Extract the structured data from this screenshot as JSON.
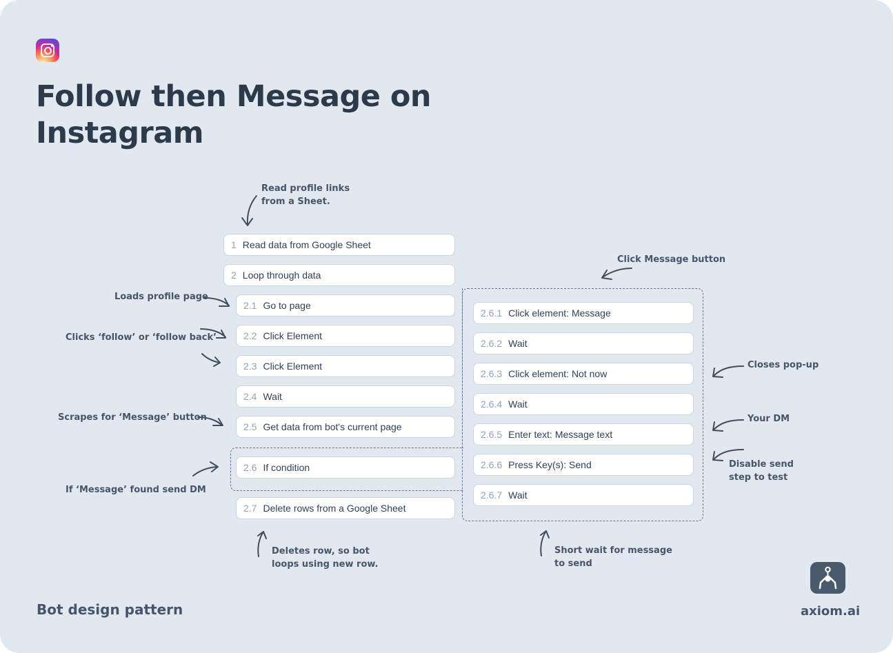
{
  "header": {
    "brand_icon": "instagram-icon",
    "title": "Follow then Message on Instagram"
  },
  "steps": [
    {
      "num": "1",
      "label": "Read data from Google Sheet"
    },
    {
      "num": "2",
      "label": "Loop through data"
    },
    {
      "num": "2.1",
      "label": "Go to page"
    },
    {
      "num": "2.2",
      "label": "Click Element"
    },
    {
      "num": "2.3",
      "label": "Click Element"
    },
    {
      "num": "2.4",
      "label": "Wait"
    },
    {
      "num": "2.5",
      "label": "Get data from bot's current page"
    },
    {
      "num": "2.6",
      "label": "If condition"
    },
    {
      "num": "2.7",
      "label": "Delete rows from a Google Sheet"
    }
  ],
  "substeps": [
    {
      "num": "2.6.1",
      "label": "Click element: Message"
    },
    {
      "num": "2.6.2",
      "label": "Wait"
    },
    {
      "num": "2.6.3",
      "label": "Click element: Not now"
    },
    {
      "num": "2.6.4",
      "label": "Wait"
    },
    {
      "num": "2.6.5",
      "label": "Enter text: Message text"
    },
    {
      "num": "2.6.6",
      "label": "Press Key(s): Send"
    },
    {
      "num": "2.6.7",
      "label": "Wait"
    }
  ],
  "annotations": {
    "read_sheet": [
      "Read profile links",
      "from a Sheet."
    ],
    "loads_profile": "Loads profile page",
    "clicks_follow": "Clicks ‘follow’ or ‘follow back’",
    "scrapes_message": "Scrapes for ‘Message’ button",
    "if_message": "If ‘Message’ found send DM",
    "deletes_row": [
      "Deletes row, so bot",
      "loops using new row."
    ],
    "click_message": "Click Message button",
    "closes_popup": "Closes pop-up",
    "your_dm": "Your DM",
    "disable_send": [
      "Disable send",
      "step to test"
    ],
    "short_wait": [
      "Short wait for message",
      "to send"
    ]
  },
  "footer": {
    "subtitle": "Bot design pattern",
    "brand_icon": "axiom-robot-claw-icon",
    "brand": "axiom.ai"
  }
}
